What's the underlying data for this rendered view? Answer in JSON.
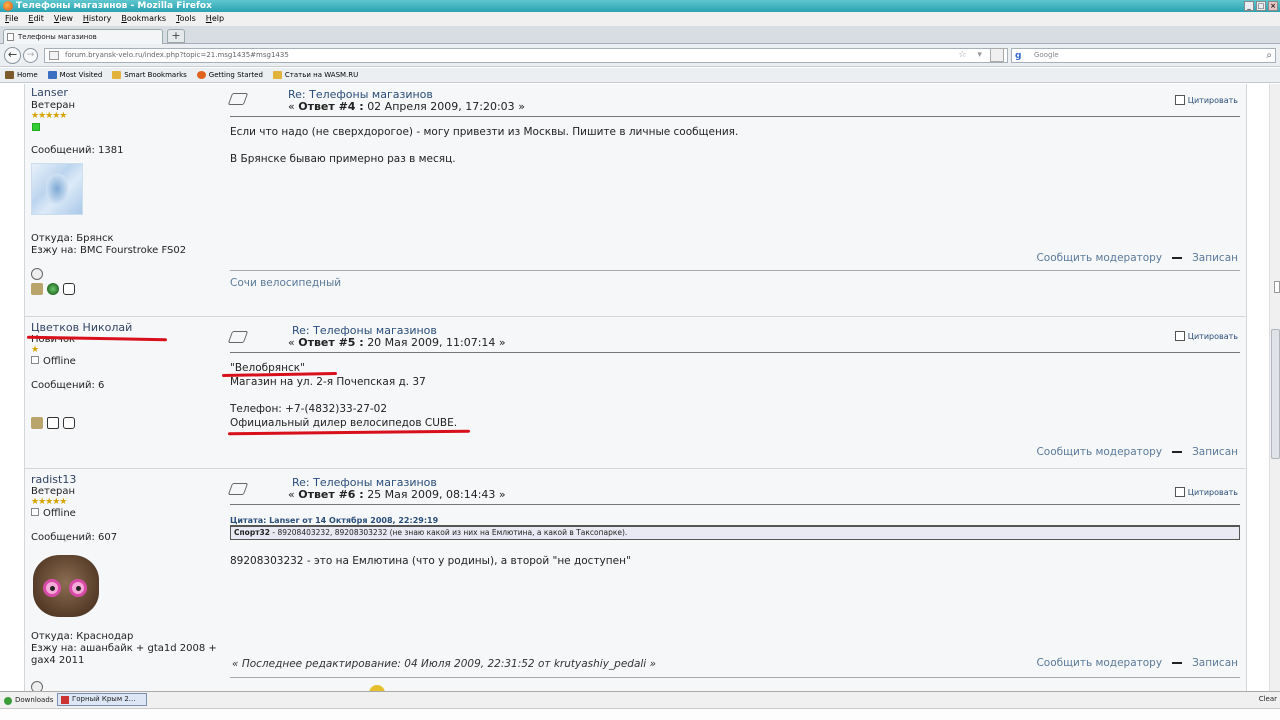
{
  "window": {
    "title": "Телефоны магазинов - Mozilla Firefox",
    "controls": [
      "_",
      "□",
      "×"
    ]
  },
  "menu": [
    "File",
    "Edit",
    "View",
    "History",
    "Bookmarks",
    "Tools",
    "Help"
  ],
  "tab": {
    "label": "Телефоны магазинов",
    "new_tab": "+"
  },
  "nav": {
    "back": "←",
    "forward": "→",
    "url": "forum.bryansk-velo.ru/index.php?topic=21.msg1435#msg1435",
    "url_icons": "☆ ▾ C",
    "search_placeholder": "Google",
    "search_engine": "g",
    "search_icon": "⌕"
  },
  "bookmarks": [
    {
      "label": "Home",
      "color": "#7d5a2c"
    },
    {
      "label": "Most Visited",
      "color": "#3a6fc2"
    },
    {
      "label": "Smart Bookmarks",
      "color": "#e2b33b"
    },
    {
      "label": "Getting Started",
      "color": "#e0641e"
    },
    {
      "label": "Статьи на WASM.RU",
      "color": "#e2b33b"
    }
  ],
  "posts": [
    {
      "user": "Lanser",
      "rank": "Ветеран",
      "stars": "★★★★★",
      "messages": "Сообщений: 1381",
      "from": "Откуда: Брянск",
      "ride": "Езжу на: BMC Fourstroke FS02",
      "title": "Re: Телефоны магазинов",
      "meta_prefix": "«",
      "meta_label": "Ответ #4 :",
      "meta_date": "02 Апреля 2009, 17:20:03",
      "meta_suffix": "»",
      "quote": "Цитировать",
      "body": [
        "Если что надо (не сверхдорогое) - могу привезти из Москвы. Пишите в личные сообщения.",
        "В Брянске бываю примерно раз в месяц."
      ],
      "report": "Сообщить модератору",
      "logged": "Записан",
      "signature": "Сочи велосипедный"
    },
    {
      "user": "Цветков Николай",
      "rank": "Новичок",
      "stars": "★",
      "status": "Offline",
      "messages": "Сообщений: 6",
      "title": "Re: Телефоны магазинов",
      "meta_prefix": "«",
      "meta_label": "Ответ #5 :",
      "meta_date": "20 Мая 2009, 11:07:14",
      "meta_suffix": "»",
      "quote": "Цитировать",
      "body": [
        "\"Велобрянск\"",
        "Магазин на ул. 2-я Почепская д. 37",
        "",
        "Телефон: +7-(4832)33-27-02",
        "Официальный дилер велосипедов CUBE."
      ],
      "report": "Сообщить модератору",
      "logged": "Записан"
    },
    {
      "user": "radist13",
      "rank": "Ветеран",
      "stars": "★★★★★",
      "status": "Offline",
      "messages": "Сообщений: 607",
      "from": "Откуда: Краснодар",
      "ride": "Езжу на: ашанбайк + gta1d 2008 + gax4 2011",
      "title": "Re: Телефоны магазинов",
      "meta_prefix": "«",
      "meta_label": "Ответ #6 :",
      "meta_date": "25 Мая 2009, 08:14:43",
      "meta_suffix": "»",
      "quote": "Цитировать",
      "quote_header": "Цитата: Lanser от 14 Октября 2008, 22:29:19",
      "quote_author": "Спорт32",
      "quote_text": " - 89208403232, 89208303232 (не знаю какой из них на Емлютина, а какой в Таксопарке).",
      "body": [
        "89208303232 - это на Емлютина (что у родины), а второй \"не доступен\""
      ],
      "edited": "« Последнее редактирование: 04 Июля 2009, 22:31:52 от krutyashiy_pedali »",
      "report": "Сообщить модератору",
      "logged": "Записан"
    }
  ],
  "annotations": {
    "underline_color": "#d8101c"
  },
  "statusbar": {
    "downloads": "Downloads",
    "task": "Горный Крым 2...",
    "clear": "Clear"
  }
}
